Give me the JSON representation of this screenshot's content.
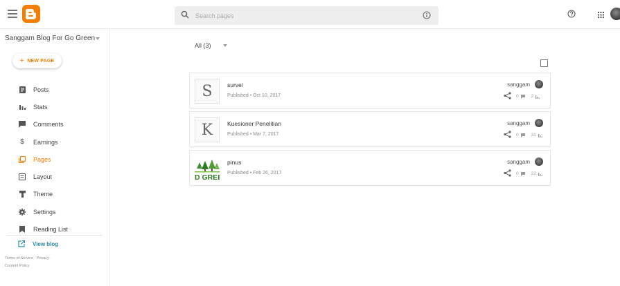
{
  "header": {
    "search_placeholder": "Search pages"
  },
  "sidebar": {
    "blog_name": "Sanggam Blog For Go Green",
    "new_page_label": "NEW PAGE",
    "items": [
      {
        "label": "Posts",
        "icon": "posts-icon"
      },
      {
        "label": "Stats",
        "icon": "stats-icon"
      },
      {
        "label": "Comments",
        "icon": "comments-icon"
      },
      {
        "label": "Earnings",
        "icon": "dollar-icon"
      },
      {
        "label": "Pages",
        "icon": "pages-icon",
        "active": true
      },
      {
        "label": "Layout",
        "icon": "layout-icon"
      },
      {
        "label": "Theme",
        "icon": "theme-brush-icon"
      },
      {
        "label": "Settings",
        "icon": "gear-icon"
      },
      {
        "label": "Reading List",
        "icon": "bookmark-icon"
      }
    ],
    "view_blog": "View blog",
    "footer": {
      "terms": "Terms of Service",
      "privacy": "Privacy",
      "content_policy": "Content Policy"
    }
  },
  "main": {
    "filter_label": "All (3)",
    "pages": [
      {
        "title": "survei",
        "meta": "Published • Oct 10, 2017",
        "author": "sanggam",
        "thumb_letter": "S",
        "comments": "0",
        "views": "2"
      },
      {
        "title": "Kuesioner Penelitian",
        "meta": "Published • Mar 7, 2017",
        "author": "sanggam",
        "thumb_letter": "K",
        "comments": "0",
        "views": "31"
      },
      {
        "title": "pinus",
        "meta": "Published • Feb 26, 2017",
        "author": "sanggam",
        "thumb_text": "D GREE",
        "comments": "0",
        "views": "22"
      }
    ]
  },
  "colors": {
    "accent": "#f57d00",
    "link": "#2a8ba0"
  }
}
